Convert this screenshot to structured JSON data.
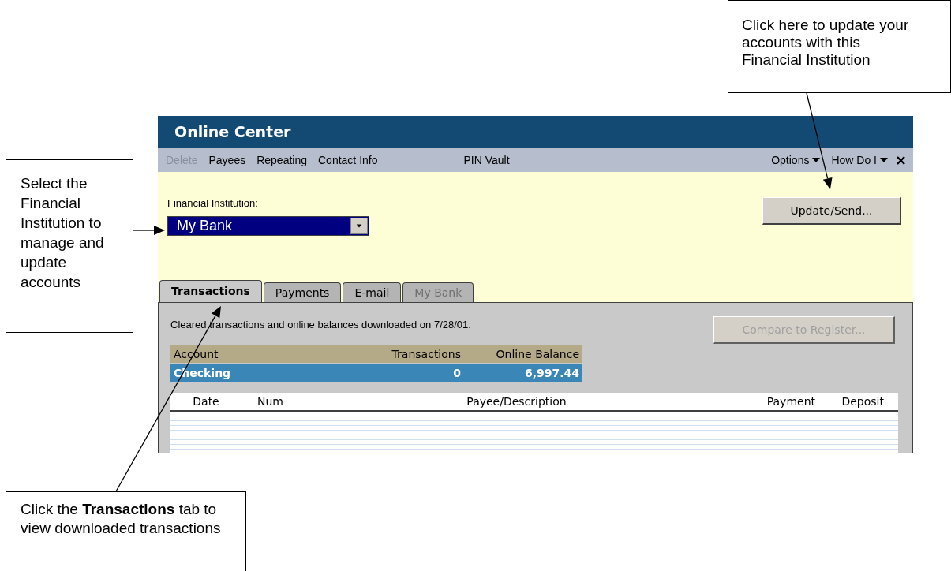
{
  "callouts": [
    {
      "text": "Click here to update your accounts with this Financial Institution"
    },
    {
      "text": "Select the Financial Institution to manage and update accounts"
    },
    {
      "text": "Click the **Transactions** tab to view downloaded transactions"
    }
  ],
  "window": {
    "title": "Online Center"
  },
  "menu": [
    {
      "label": "Delete",
      "kind": "plain",
      "disabled": true
    },
    {
      "label": "Payees",
      "kind": "plain",
      "disabled": false
    },
    {
      "label": "Repeating",
      "kind": "plain",
      "disabled": false
    },
    {
      "label": "Contact Info",
      "kind": "plain",
      "disabled": false
    },
    {
      "label": "PIN Vault",
      "kind": "center",
      "disabled": false
    },
    {
      "label": "Options",
      "kind": "dropdown",
      "disabled": false
    },
    {
      "label": "How Do I",
      "kind": "dropdown",
      "disabled": false
    }
  ],
  "institution": {
    "label": "Financial Institution:",
    "value": "My Bank"
  },
  "update_button": {
    "label": "Update/Send..."
  },
  "tabs": [
    {
      "label": "Transactions",
      "selected": true,
      "disabled": false
    },
    {
      "label": "Payments",
      "selected": false,
      "disabled": false
    },
    {
      "label": "E-mail",
      "selected": false,
      "disabled": false
    },
    {
      "label": "My Bank",
      "selected": false,
      "disabled": true
    }
  ],
  "status_text": "Cleared transactions and online balances downloaded on 7/28/01.",
  "compare_button": {
    "label": "Compare to Register...",
    "disabled": true
  },
  "accounts": {
    "columns": [
      "Account",
      "Transactions",
      "Online Balance"
    ],
    "rows": [
      {
        "cells": [
          "Checking",
          "0",
          "6,997.44"
        ],
        "selected": true
      }
    ]
  },
  "register": {
    "columns": [
      "Date",
      "Num",
      "Payee/Description",
      "Payment",
      "Deposit"
    ]
  }
}
